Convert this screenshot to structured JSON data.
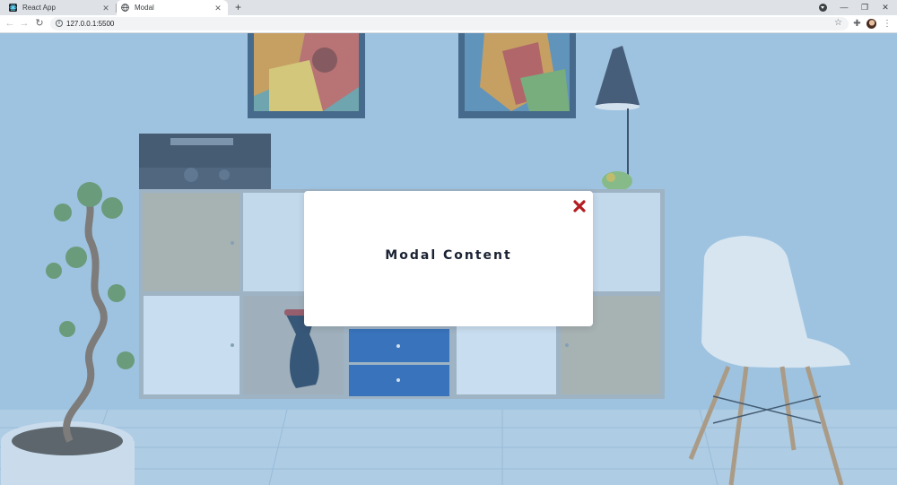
{
  "browser": {
    "tabs": [
      {
        "title": "React App",
        "favicon": "react-app-favicon"
      },
      {
        "title": "Modal",
        "favicon": "globe-icon"
      }
    ],
    "address": "127.0.0.1:5500",
    "close_glyph": "✕",
    "new_tab_glyph": "+",
    "back_glyph": "←",
    "forward_glyph": "→",
    "reload_glyph": "↻",
    "info_glyph": "i",
    "star_glyph": "☆",
    "extensions_glyph": "✚",
    "menu_glyph": "⋮",
    "minimize_glyph": "—",
    "restore_glyph": "❐",
    "window_close_glyph": "✕"
  },
  "modal": {
    "text": "Modal Content",
    "close_icon": "close-x-icon",
    "close_color": "#b31d22"
  },
  "background": {
    "description_icon": "living-room-background-image"
  }
}
